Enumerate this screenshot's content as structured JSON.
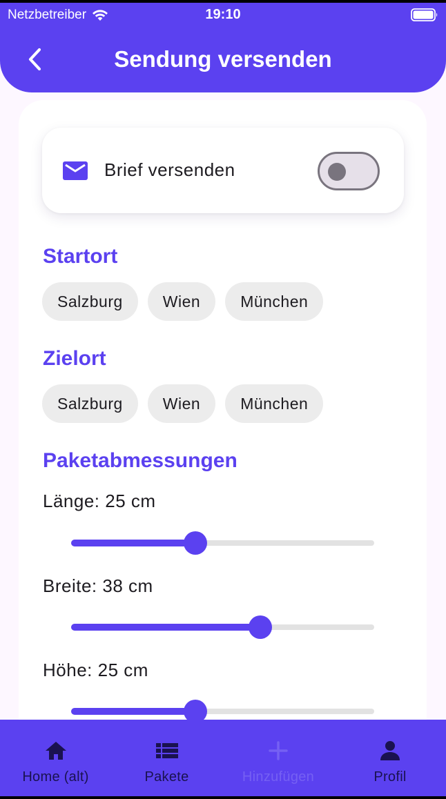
{
  "status_bar": {
    "carrier": "Netzbetreiber",
    "time": "19:10",
    "wifi_icon": "wifi-icon",
    "battery_icon": "battery-icon"
  },
  "header": {
    "title": "Sendung versenden",
    "back_icon": "chevron-left-icon",
    "background_color": "#5b41f0"
  },
  "letter_toggle": {
    "label": "Brief versenden",
    "icon": "mail-icon",
    "enabled": false
  },
  "start": {
    "title": "Startort",
    "options": [
      "Salzburg",
      "Wien",
      "München"
    ]
  },
  "destination": {
    "title": "Zielort",
    "options": [
      "Salzburg",
      "Wien",
      "München"
    ]
  },
  "dimensions": {
    "title": "Paketabmessungen",
    "length": {
      "label": "Länge: 25 cm",
      "value_fraction": 0.41
    },
    "width": {
      "label": "Breite: 38 cm",
      "value_fraction": 0.625
    },
    "height": {
      "label": "Höhe: 25 cm",
      "value_fraction": 0.41
    }
  },
  "bottom_nav": {
    "items": [
      {
        "label": "Home (alt)",
        "icon": "home-icon"
      },
      {
        "label": "Pakete",
        "icon": "list-icon"
      },
      {
        "label": "Hinzufügen",
        "icon": "plus-icon"
      },
      {
        "label": "Profil",
        "icon": "person-icon"
      }
    ]
  },
  "colors": {
    "accent": "#5b41f0",
    "chip_background": "#ececec",
    "page_background": "#fdf7ff"
  }
}
